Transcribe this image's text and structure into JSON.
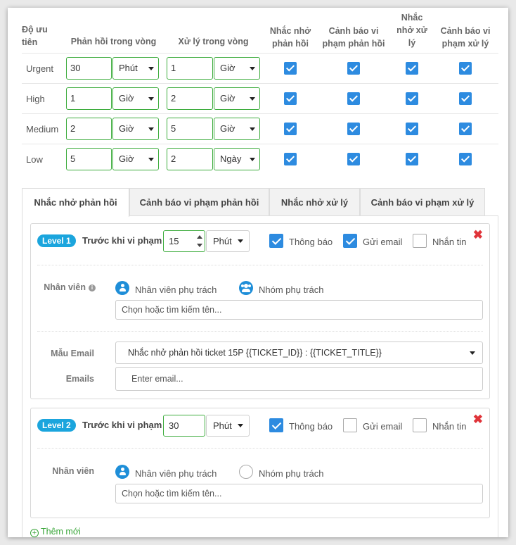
{
  "sla_table": {
    "headers": {
      "priority": "Độ ưu tiên",
      "response_within": "Phản hồi trong vòng",
      "process_within": "Xử lý trong vòng",
      "remind_response": "Nhắc nhở phản hồi",
      "warn_response": "Cảnh báo vi phạm phản hồi",
      "remind_process": "Nhắc nhở xử lý",
      "warn_process": "Cảnh báo vi phạm xử lý"
    },
    "rows": [
      {
        "priority": "Urgent",
        "response_value": "30",
        "response_unit": "Phút",
        "process_value": "1",
        "process_unit": "Giờ",
        "remind_response": true,
        "warn_response": true,
        "remind_process": true,
        "warn_process": true
      },
      {
        "priority": "High",
        "response_value": "1",
        "response_unit": "Giờ",
        "process_value": "2",
        "process_unit": "Giờ",
        "remind_response": true,
        "warn_response": true,
        "remind_process": true,
        "warn_process": true
      },
      {
        "priority": "Medium",
        "response_value": "2",
        "response_unit": "Giờ",
        "process_value": "5",
        "process_unit": "Giờ",
        "remind_response": true,
        "warn_response": true,
        "remind_process": true,
        "warn_process": true
      },
      {
        "priority": "Low",
        "response_value": "5",
        "response_unit": "Giờ",
        "process_value": "2",
        "process_unit": "Ngày",
        "remind_response": true,
        "warn_response": true,
        "remind_process": true,
        "warn_process": true
      }
    ]
  },
  "tabs": [
    {
      "label": "Nhắc nhở phản hồi",
      "active": true
    },
    {
      "label": "Cảnh báo vi phạm phản hồi",
      "active": false
    },
    {
      "label": "Nhắc nhở xử lý",
      "active": false
    },
    {
      "label": "Cảnh báo vi phạm xử lý",
      "active": false
    }
  ],
  "levels": [
    {
      "badge": "Level 1",
      "before_label": "Trước khi vi phạm",
      "value": "15",
      "unit": "Phút",
      "notify": {
        "label": "Thông báo",
        "checked": true
      },
      "email": {
        "label": "Gửi email",
        "checked": true
      },
      "sms": {
        "label": "Nhắn tin",
        "checked": false
      },
      "staff_label": "Nhân viên",
      "staff_option_owner": "Nhân viên phụ trách",
      "staff_option_group": "Nhóm phụ trách",
      "staff_owner_selected": true,
      "staff_group_selected": true,
      "search_placeholder": "Chọn hoặc tìm kiếm tên...",
      "email_template_label": "Mẫu Email",
      "email_template_value": "Nhắc nhở phản hồi ticket 15P {{TICKET_ID}} : {{TICKET_TITLE}}",
      "emails_label": "Emails",
      "emails_placeholder": "Enter email..."
    },
    {
      "badge": "Level 2",
      "before_label": "Trước khi vi phạm",
      "value": "30",
      "unit": "Phút",
      "notify": {
        "label": "Thông báo",
        "checked": true
      },
      "email": {
        "label": "Gửi email",
        "checked": false
      },
      "sms": {
        "label": "Nhắn tin",
        "checked": false
      },
      "staff_label": "Nhân viên",
      "staff_option_owner": "Nhân viên phụ trách",
      "staff_option_group": "Nhóm phụ trách",
      "staff_owner_selected": true,
      "staff_group_selected": false,
      "search_placeholder": "Chọn hoặc tìm kiếm tên..."
    }
  ],
  "add_new_label": "Thêm mới",
  "close_symbol": "✖",
  "colors": {
    "accent_green": "#3dac3d",
    "checkbox_blue": "#2d8be0",
    "badge_blue": "#1ba5dd",
    "close_red": "#e0343a"
  }
}
